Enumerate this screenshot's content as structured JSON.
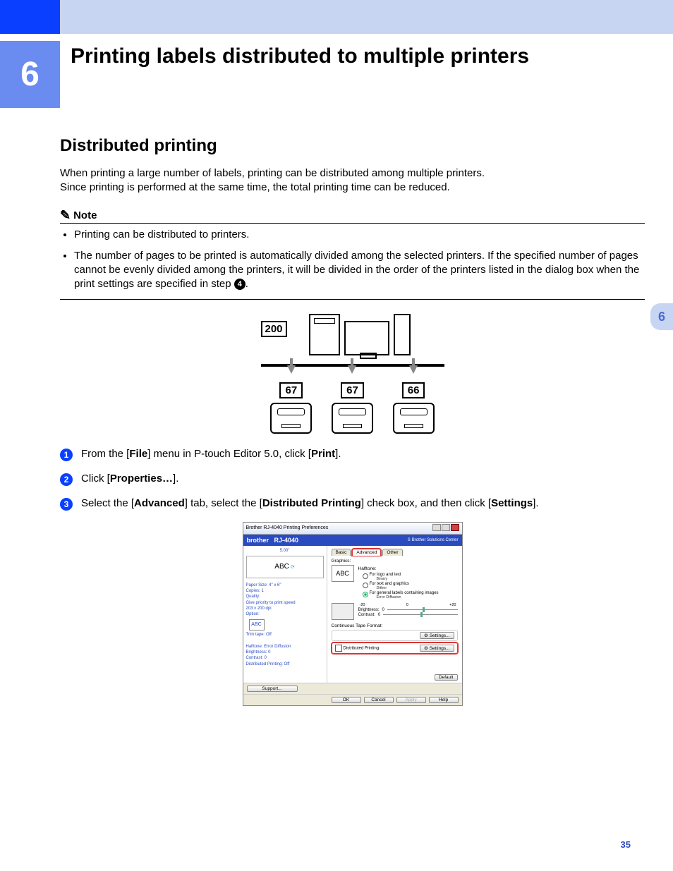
{
  "chapter": {
    "number": "6",
    "title": "Printing labels distributed to multiple printers"
  },
  "section": {
    "title": "Distributed printing"
  },
  "intro": {
    "line1": "When printing a large number of labels, printing can be distributed among multiple printers.",
    "line2": "Since printing is performed at the same time, the total printing time can be reduced."
  },
  "note": {
    "label": "Note",
    "bullet1": "Printing can be distributed to printers.",
    "bullet2_pre": "The number of pages to be printed is automatically divided among the selected printers. If the specified number of pages cannot be evenly divided among the printers, it will be divided in the order of the printers listed in the dialog box when the print settings are specified in step ",
    "bullet2_stepnum": "4",
    "bullet2_post": "."
  },
  "diagram": {
    "total": "200",
    "p1": "67",
    "p2": "67",
    "p3": "66"
  },
  "steps": {
    "s1": {
      "pre": "From the [",
      "b1": "File",
      "mid": "] menu in P-touch Editor 5.0, click [",
      "b2": "Print",
      "post": "]."
    },
    "s2": {
      "pre": "Click [",
      "b1": "Properties…",
      "post": "]."
    },
    "s3": {
      "pre": "Select the [",
      "b1": "Advanced",
      "mid1": "] tab, select the [",
      "b2": "Distributed Printing",
      "mid2": "] check box, and then click [",
      "b3": "Settings",
      "post": "]."
    }
  },
  "dialog": {
    "title": "Brother RJ-4040 Printing Preferences",
    "brand": "brother",
    "model": "RJ-4040",
    "solutions": "Brother\nSolutions Center",
    "size": "5.00\"",
    "abc": "ABC",
    "info": {
      "paper": "Paper Size: 4\" x 6\"",
      "copies": "Copies: 1",
      "quality": "Quality:",
      "quality2": "   Give priority to print speed",
      "dpi": "   203 x 200 dpi",
      "option": "Option:",
      "trim": "Trim tape: Off",
      "half": "Halftone: Error Diffusion",
      "bright": "Brightness:  0",
      "contrast": "Contrast:  0",
      "dist": "Distributed Printing: Off"
    },
    "support": "Support...",
    "tabs": {
      "basic": "Basic",
      "advanced": "Advanced",
      "other": "Other"
    },
    "graphics": "Graphics:",
    "halftone": "Halftone:",
    "r1": "For logo and text",
    "r1s": "Binary",
    "r2": "For text and graphics",
    "r2s": "Dither",
    "r3": "For general labels containing images",
    "r3s": "Error Diffusion",
    "rangeMinus": "-20",
    "rangeZero": "0",
    "rangePlus": "+20",
    "brightness": "Brightness:",
    "brightVal": "0",
    "contrast": "Contrast:",
    "contrastVal": "0",
    "ctf": "Continuous Tape Format:",
    "dp": "Distributed Printing:",
    "settings": "Settings...",
    "default": "Default",
    "ok": "OK",
    "cancel": "Cancel",
    "apply": "Apply",
    "help": "Help"
  },
  "sidetab": "6",
  "pagenum": "35"
}
